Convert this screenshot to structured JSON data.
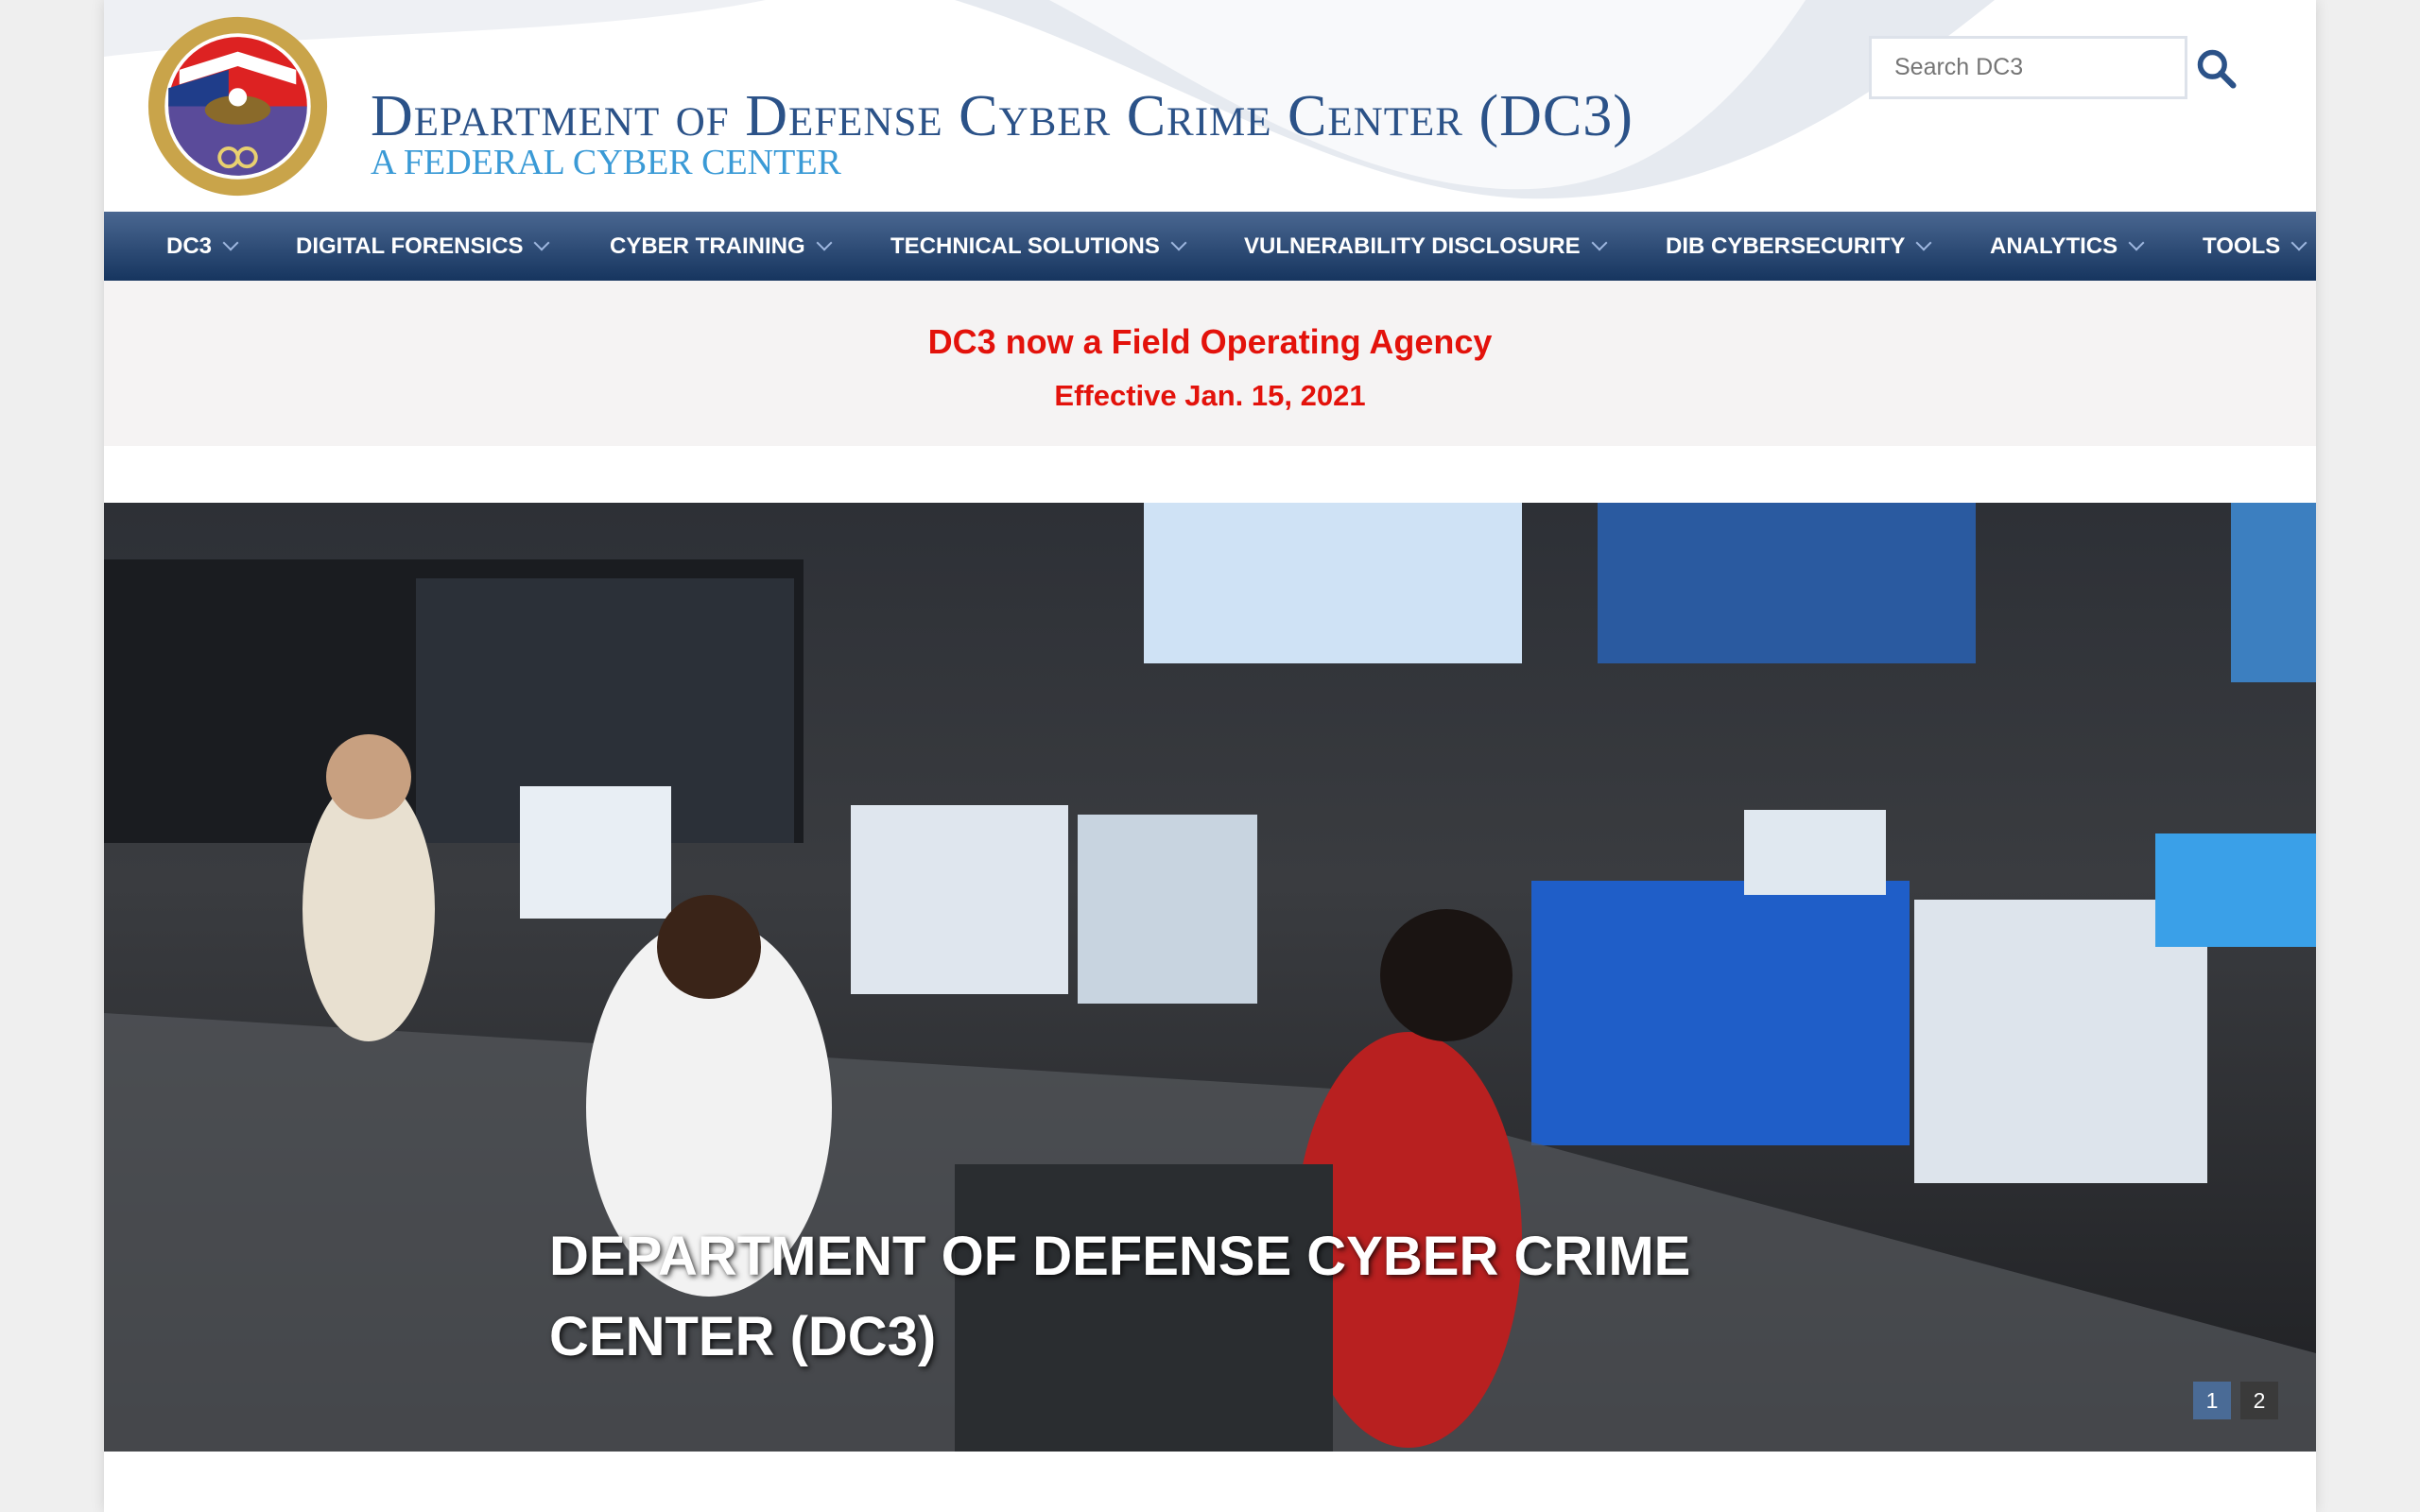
{
  "header": {
    "title": "Department of Defense Cyber Crime Center (DC3)",
    "subtitle": "A FEDERAL CYBER CENTER",
    "logo_text": "Department of Defense Cyber Crime Center",
    "search_placeholder": "Search DC3"
  },
  "nav": {
    "items": [
      {
        "label": "DC3"
      },
      {
        "label": "DIGITAL FORENSICS"
      },
      {
        "label": "CYBER TRAINING"
      },
      {
        "label": "TECHNICAL SOLUTIONS"
      },
      {
        "label": "VULNERABILITY DISCLOSURE"
      },
      {
        "label": "DIB CYBERSECURITY"
      },
      {
        "label": "ANALYTICS"
      },
      {
        "label": "TOOLS"
      }
    ]
  },
  "banner": {
    "line1": "DC3 now a Field Operating Agency",
    "line2": "Effective Jan. 15, 2021"
  },
  "hero": {
    "caption": "Department of Defense Cyber Crime Center (DC3)",
    "pages": [
      "1",
      "2"
    ],
    "active_page": 1
  },
  "colors": {
    "nav": "#2a4a78",
    "banner_text": "#e3120b",
    "title": "#2b5288",
    "pager_active": "#4a6b96"
  }
}
